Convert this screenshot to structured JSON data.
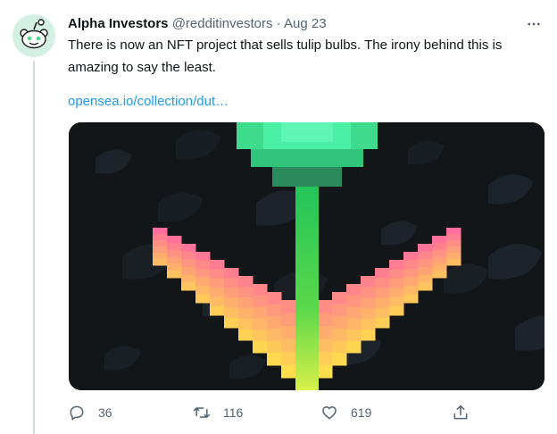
{
  "author": {
    "name": "Alpha Investors",
    "handle": "@redditinvestors",
    "separator": "·",
    "date": "Aug 23",
    "avatar_icon": "reddit-snoo-icon"
  },
  "tweet": {
    "text": "There is now an NFT project that sells tulip bulbs. The irony behind this is amazing to say the least.",
    "link": "opensea.io/collection/dut…"
  },
  "more_icon": "more-dots-icon",
  "media": {
    "image_icon": "pixel-tulip-nft-image"
  },
  "actions": {
    "reply": {
      "icon": "reply-icon",
      "count": "36"
    },
    "retweet": {
      "icon": "retweet-icon",
      "count": "116"
    },
    "like": {
      "icon": "heart-icon",
      "count": "619"
    },
    "share": {
      "icon": "share-icon"
    }
  },
  "colors": {
    "link": "#1d9bf0",
    "secondary_text": "#536471",
    "tulip_stem": "#2ed65a",
    "tulip_bulb": "#4cf0a4",
    "petal_pink": "#ff6e9c",
    "petal_yellow": "#ffe04a"
  }
}
